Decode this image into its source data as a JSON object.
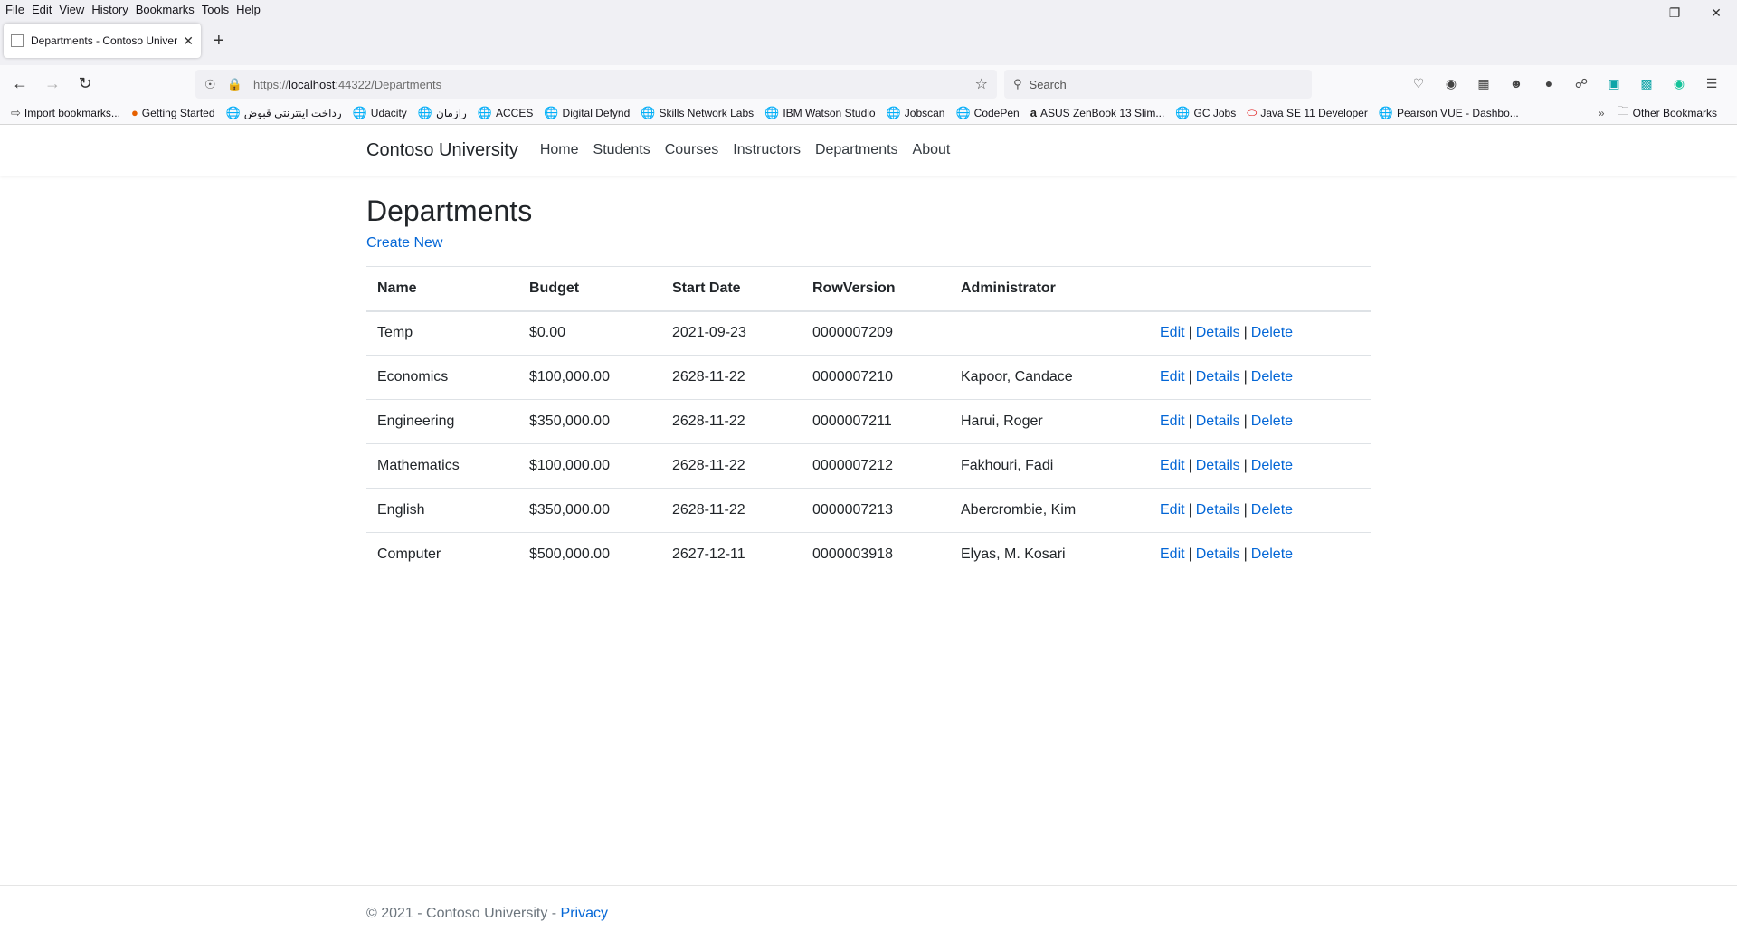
{
  "browser": {
    "menu": [
      "File",
      "Edit",
      "View",
      "History",
      "Bookmarks",
      "Tools",
      "Help"
    ],
    "tab_title": "Departments - Contoso Universi",
    "url_prefix": "https://",
    "url_host": "localhost",
    "url_rest": ":44322/Departments",
    "search_placeholder": "Search",
    "bookmarks": [
      {
        "label": "Import bookmarks...",
        "icon": "import-icon"
      },
      {
        "label": "Getting Started",
        "icon": "firefox-icon"
      },
      {
        "label": "رداخت اینترنتی قبوض",
        "icon": "globe-icon"
      },
      {
        "label": "Udacity",
        "icon": "globe-icon"
      },
      {
        "label": "رازمان",
        "icon": "globe-icon"
      },
      {
        "label": "ACCES",
        "icon": "globe-icon"
      },
      {
        "label": "Digital Defynd",
        "icon": "globe-icon"
      },
      {
        "label": "Skills Network Labs",
        "icon": "globe-icon"
      },
      {
        "label": "IBM Watson Studio",
        "icon": "globe-icon"
      },
      {
        "label": "Jobscan",
        "icon": "globe-icon"
      },
      {
        "label": "CodePen",
        "icon": "globe-icon"
      },
      {
        "label": "ASUS ZenBook 13 Slim...",
        "icon": "amazon-icon"
      },
      {
        "label": "GC Jobs",
        "icon": "globe-icon"
      },
      {
        "label": "Java SE 11 Developer",
        "icon": "oracle-icon"
      },
      {
        "label": "Pearson VUE - Dashbo...",
        "icon": "globe-icon"
      }
    ],
    "other_bookmarks": "Other Bookmarks"
  },
  "site": {
    "brand": "Contoso University",
    "nav": [
      "Home",
      "Students",
      "Courses",
      "Instructors",
      "Departments",
      "About"
    ]
  },
  "main": {
    "title": "Departments",
    "create_new": "Create New",
    "columns": [
      "Name",
      "Budget",
      "Start Date",
      "RowVersion",
      "Administrator"
    ],
    "rows": [
      [
        "Temp",
        "$0.00",
        "2021-09-23",
        "0000007209",
        ""
      ],
      [
        "Economics",
        "$100,000.00",
        "2628-11-22",
        "0000007210",
        "Kapoor, Candace"
      ],
      [
        "Engineering",
        "$350,000.00",
        "2628-11-22",
        "0000007211",
        "Harui, Roger"
      ],
      [
        "Mathematics",
        "$100,000.00",
        "2628-11-22",
        "0000007212",
        "Fakhouri, Fadi"
      ],
      [
        "English",
        "$350,000.00",
        "2628-11-22",
        "0000007213",
        "Abercrombie, Kim"
      ],
      [
        "Computer",
        "$500,000.00",
        "2627-12-11",
        "0000003918",
        "Elyas, M. Kosari"
      ]
    ],
    "actions": {
      "edit": "Edit",
      "details": "Details",
      "delete": "Delete",
      "separator": "|"
    }
  },
  "footer": {
    "text": "© 2021 - Contoso University - ",
    "privacy": "Privacy"
  },
  "colors": {
    "link": "#0366d6",
    "text": "#212529",
    "border": "#dee2e6"
  }
}
